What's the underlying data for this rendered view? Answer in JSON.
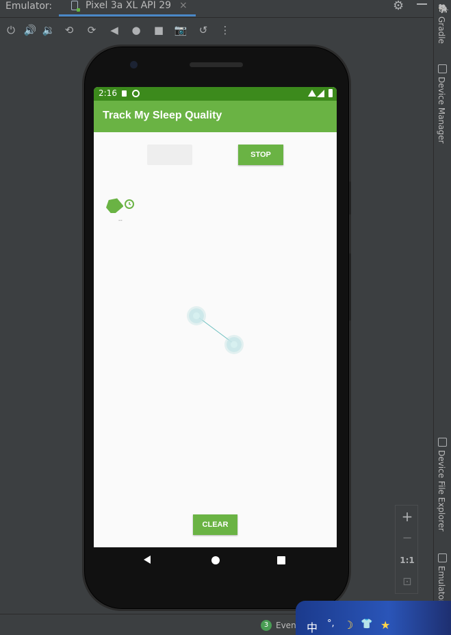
{
  "ide": {
    "panel_label": "Emulator:",
    "device_tab": "Pixel 3a XL API 29",
    "tab_close": "×"
  },
  "toolbar": {
    "buttons": [
      {
        "name": "power-icon",
        "glyph": "⏻"
      },
      {
        "name": "volume-up-icon",
        "glyph": "🔊"
      },
      {
        "name": "volume-down-icon",
        "glyph": "🔉"
      },
      {
        "name": "rotate-left-icon",
        "glyph": "⟲"
      },
      {
        "name": "rotate-right-icon",
        "glyph": "⟳"
      },
      {
        "name": "back-icon",
        "glyph": "◀"
      },
      {
        "name": "home-icon",
        "glyph": "●"
      },
      {
        "name": "overview-icon",
        "glyph": "■"
      },
      {
        "name": "camera-icon",
        "glyph": "📷"
      },
      {
        "name": "snapshot-icon",
        "glyph": "↺"
      },
      {
        "name": "more-icon",
        "glyph": "⋮"
      }
    ]
  },
  "right_tools": {
    "gradle": "Gradle",
    "device_manager": "Device Manager",
    "device_file_explorer": "Device File Explorer",
    "emulator": "Emulator"
  },
  "phone": {
    "status_time": "2:16",
    "app_title": "Track My Sleep Quality",
    "start_label": "",
    "stop_label": "STOP",
    "clear_label": "CLEAR",
    "night_text": "--"
  },
  "zoom": {
    "zoom_in": "+",
    "zoom_out": "−",
    "one_to_one": "1:1",
    "fit": "⊡"
  },
  "bottom_bar": {
    "event_count": "3",
    "event_label": "Even"
  },
  "ime": {
    "mode": "中",
    "punct": "°,",
    "moon": "☽",
    "shirt": "👕",
    "star": "★"
  },
  "colors": {
    "primary": "#6ab344",
    "status_bar": "#3c8a1c",
    "ide_bg": "#3c3f41",
    "tab_underline": "#4a88c7"
  }
}
